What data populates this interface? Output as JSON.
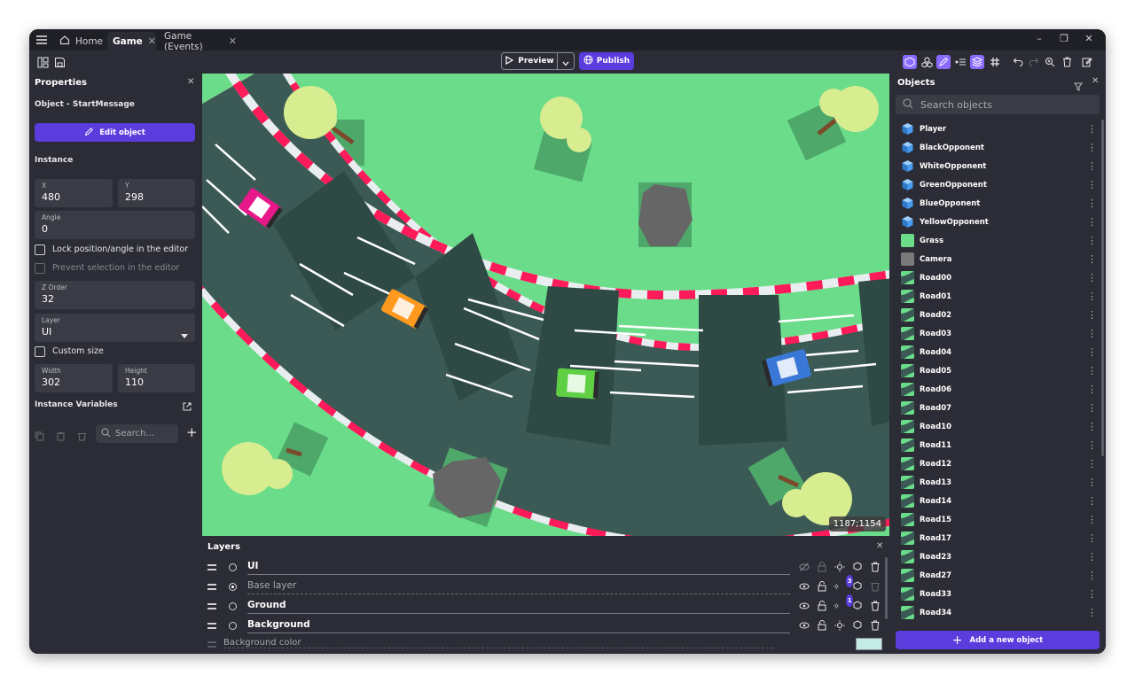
{
  "tabs": [
    {
      "label": "Home",
      "icon": "home-icon"
    },
    {
      "label": "Game",
      "active": true
    },
    {
      "label": "Game (Events)"
    }
  ],
  "toolbar": {
    "preview_label": "Preview",
    "publish_label": "Publish",
    "accent": "#5b3cdd"
  },
  "properties": {
    "title": "Properties",
    "object_line": "Object  - StartMessage",
    "edit_label": "Edit object",
    "instance_label": "Instance",
    "x": {
      "label": "X",
      "value": "480"
    },
    "y": {
      "label": "Y",
      "value": "298"
    },
    "angle": {
      "label": "Angle",
      "value": "0"
    },
    "lock_label": "Lock position/angle in the editor",
    "prevent_label": "Prevent selection in the editor",
    "zorder": {
      "label": "Z Order",
      "value": "32"
    },
    "layer": {
      "label": "Layer",
      "value": "UI"
    },
    "custom_size_label": "Custom size",
    "width": {
      "label": "Width",
      "value": "302"
    },
    "height": {
      "label": "Height",
      "value": "110"
    },
    "vars_label": "Instance Variables",
    "search_placeholder": "Search..."
  },
  "canvas": {
    "coords": "1187;1154",
    "grass_color": "#6adc8a"
  },
  "layers": {
    "title": "Layers",
    "items": [
      {
        "name": "UI",
        "selected": false,
        "dim": false
      },
      {
        "name": "Base layer",
        "selected": true,
        "dim": true,
        "badge": "3"
      },
      {
        "name": "Ground",
        "selected": false,
        "dim": false,
        "badge": "1"
      },
      {
        "name": "Background",
        "selected": false,
        "dim": false
      }
    ],
    "bg_color_label": "Background color"
  },
  "objects": {
    "title": "Objects",
    "search_placeholder": "Search objects",
    "add_label": "Add a new object",
    "items": [
      {
        "name": "Player",
        "kind": "cube"
      },
      {
        "name": "BlackOpponent",
        "kind": "cube"
      },
      {
        "name": "WhiteOpponent",
        "kind": "cube"
      },
      {
        "name": "GreenOpponent",
        "kind": "cube"
      },
      {
        "name": "BlueOpponent",
        "kind": "cube"
      },
      {
        "name": "YellowOpponent",
        "kind": "cube"
      },
      {
        "name": "Grass",
        "kind": "grass"
      },
      {
        "name": "Camera",
        "kind": "camera"
      },
      {
        "name": "Road00",
        "kind": "road"
      },
      {
        "name": "Road01",
        "kind": "road"
      },
      {
        "name": "Road02",
        "kind": "road"
      },
      {
        "name": "Road03",
        "kind": "road"
      },
      {
        "name": "Road04",
        "kind": "road"
      },
      {
        "name": "Road05",
        "kind": "road"
      },
      {
        "name": "Road06",
        "kind": "road"
      },
      {
        "name": "Road07",
        "kind": "road"
      },
      {
        "name": "Road10",
        "kind": "road"
      },
      {
        "name": "Road11",
        "kind": "road"
      },
      {
        "name": "Road12",
        "kind": "road"
      },
      {
        "name": "Road13",
        "kind": "road"
      },
      {
        "name": "Road14",
        "kind": "road"
      },
      {
        "name": "Road15",
        "kind": "road"
      },
      {
        "name": "Road17",
        "kind": "road"
      },
      {
        "name": "Road23",
        "kind": "road"
      },
      {
        "name": "Road27",
        "kind": "road"
      },
      {
        "name": "Road33",
        "kind": "road"
      },
      {
        "name": "Road34",
        "kind": "road"
      }
    ]
  }
}
